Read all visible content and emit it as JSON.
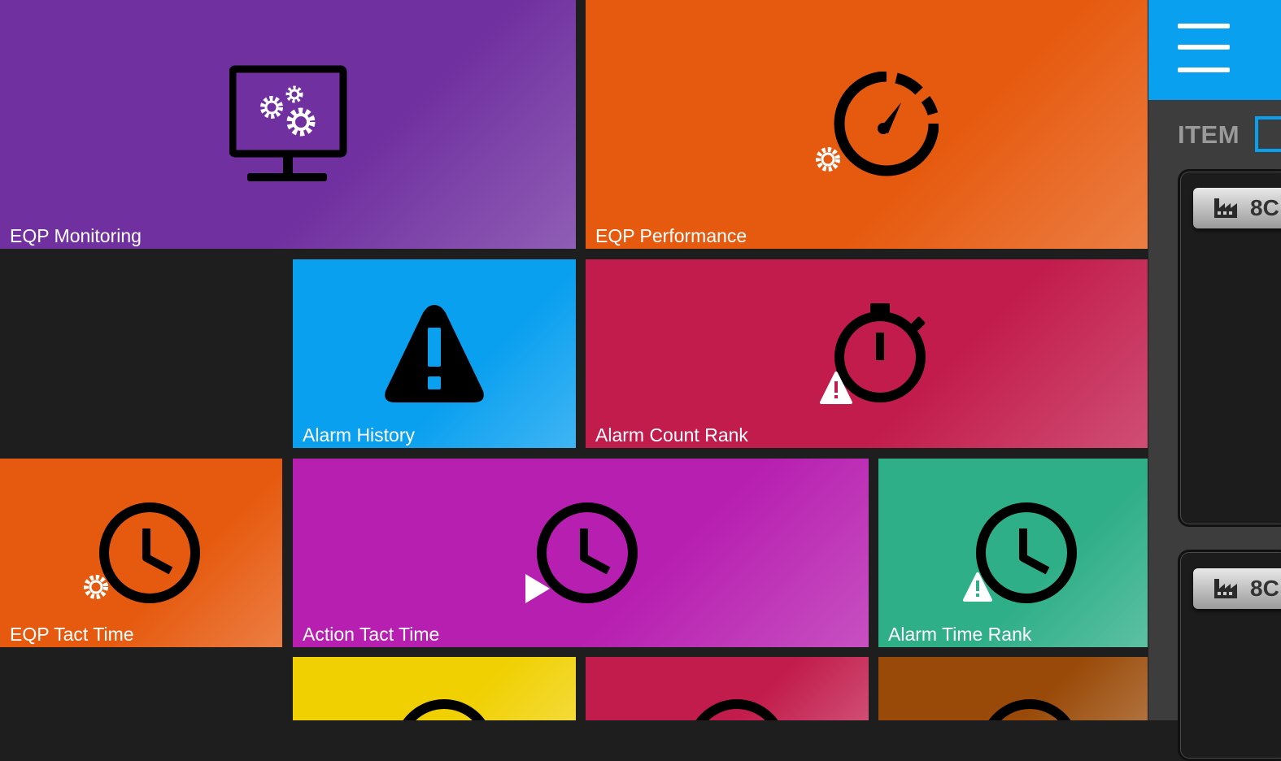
{
  "tiles": [
    {
      "key": "eqp_monitoring",
      "label": "EQP Monitoring",
      "color": "#7030a0",
      "icon": "monitor-gears-icon"
    },
    {
      "key": "eqp_performance",
      "label": "EQP Performance",
      "color": "#e65a0f",
      "icon": "speedometer-gear-icon"
    },
    {
      "key": "alarm_history",
      "label": "Alarm History",
      "color": "#0aa0f0",
      "icon": "warning-icon"
    },
    {
      "key": "alarm_count_rank",
      "label": "Alarm Count Rank",
      "color": "#c21c4c",
      "icon": "stopwatch-warning-icon"
    },
    {
      "key": "eqp_tact_time",
      "label": "EQP Tact Time",
      "color": "#e65a0f",
      "icon": "clock-gear-icon"
    },
    {
      "key": "action_tact_time",
      "label": "Action Tact Time",
      "color": "#b71fb0",
      "icon": "clock-play-icon"
    },
    {
      "key": "alarm_time_rank",
      "label": "Alarm Time Rank",
      "color": "#2faf88",
      "icon": "clock-warning-icon"
    },
    {
      "key": "tile_yellow",
      "label": "",
      "color": "#f0d000",
      "icon": "clock-icon"
    },
    {
      "key": "tile_crimson",
      "label": "",
      "color": "#c21c4c",
      "icon": "clock-icon"
    },
    {
      "key": "tile_brown",
      "label": "",
      "color": "#9a4a08",
      "icon": "clock-icon"
    }
  ],
  "panel": {
    "item_label": "ITEM",
    "accent": "#0aa0f0",
    "cards": [
      {
        "badge_text": "8C",
        "icon": "factory-icon"
      },
      {
        "badge_text": "8C",
        "icon": "factory-icon"
      }
    ]
  }
}
